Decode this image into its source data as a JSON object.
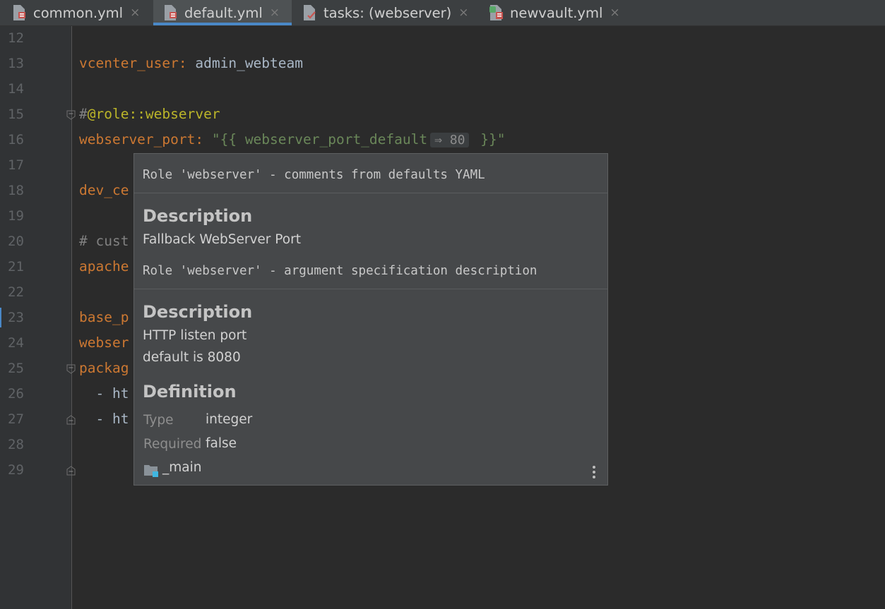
{
  "tabs": [
    {
      "label": "common.yml",
      "icon": "yaml-file-icon",
      "active": false
    },
    {
      "label": "default.yml",
      "icon": "yaml-file-icon",
      "active": true
    },
    {
      "label": "tasks: (webserver)",
      "icon": "tasks-file-icon",
      "active": false
    },
    {
      "label": "newvault.yml",
      "icon": "vault-file-icon",
      "active": false
    }
  ],
  "close_glyph": "×",
  "line_numbers": [
    "12",
    "13",
    "14",
    "15",
    "16",
    "17",
    "18",
    "19",
    "20",
    "21",
    "22",
    "23",
    "24",
    "25",
    "26",
    "27",
    "28",
    "29"
  ],
  "code": {
    "l13_key": "vcenter_user",
    "l13_colon": ": ",
    "l13_val": "admin_webteam",
    "l15_hash": "#",
    "l15_ann": "@role::webserver",
    "l16_key": "webserver_port",
    "l16_colon": ": ",
    "l16_str_open": "\"{{ webserver_port_default",
    "l16_inlay": "⇒ 80",
    "l16_str_close": " }}\"",
    "l18": "dev_ce",
    "l20": "# cust",
    "l21": "apache",
    "l23": "base_p",
    "l24": "webser",
    "l25": "packag",
    "l26": "  - ht",
    "l27": "  - ht"
  },
  "popup": {
    "title1": "Role 'webserver' - comments from defaults YAML",
    "desc_heading1": "Description",
    "desc_text1": "Fallback WebServer Port",
    "title2": "Role 'webserver' - argument specification description",
    "desc_heading2": "Description",
    "desc_text2a": "HTTP listen port",
    "desc_text2b": "default is 8080",
    "def_heading": "Definition",
    "type_label": "Type",
    "type_value": "integer",
    "required_label": "Required",
    "required_value": "false",
    "module_label": "_main",
    "module_icon": "folder-icon",
    "more_icon": "more-vertical-icon"
  },
  "colors": {
    "keyword": "#cc7832",
    "annotation": "#bbb529",
    "string": "#6a8759",
    "accent": "#4a88c7"
  }
}
